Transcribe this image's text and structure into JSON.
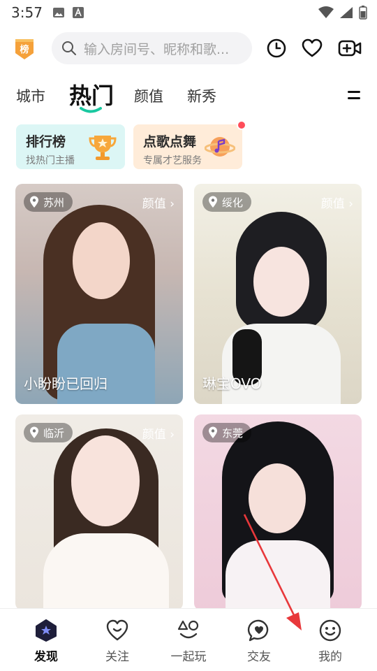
{
  "status_bar": {
    "time": "3:57"
  },
  "header": {
    "rank_badge_label": "榜",
    "search_placeholder": "输入房间号、昵称和歌...",
    "icons": [
      "history-icon",
      "favorite-icon",
      "live-video-icon"
    ]
  },
  "tabs": [
    {
      "label": "城市",
      "active": false
    },
    {
      "label": "热门",
      "active": true
    },
    {
      "label": "颜值",
      "active": false
    },
    {
      "label": "新秀",
      "active": false
    }
  ],
  "features": [
    {
      "title": "排行榜",
      "subtitle": "找热门主播",
      "icon": "trophy-icon",
      "bg": "#dcf6f5"
    },
    {
      "title": "点歌点舞",
      "subtitle": "专属才艺服务",
      "icon": "music-planet-icon",
      "bg": "#ffecd9",
      "badge": true
    }
  ],
  "cards": [
    {
      "location": "苏州",
      "category": "颜值",
      "name": "小盼盼已回归"
    },
    {
      "location": "绥化",
      "category": "颜值",
      "name": "琳宝OVO"
    },
    {
      "location": "临沂",
      "category": "颜值",
      "name": ""
    },
    {
      "location": "东莞",
      "category": "",
      "name": ""
    }
  ],
  "bottom_nav": [
    {
      "label": "发现",
      "icon": "discover-icon",
      "active": true
    },
    {
      "label": "关注",
      "icon": "heart-smile-icon",
      "active": false
    },
    {
      "label": "一起玩",
      "icon": "play-together-icon",
      "active": false
    },
    {
      "label": "交友",
      "icon": "chat-heart-icon",
      "active": false
    },
    {
      "label": "我的",
      "icon": "smile-face-icon",
      "active": false
    }
  ],
  "colors": {
    "accent": "#19c8a0",
    "arrow": "#e8383b"
  }
}
